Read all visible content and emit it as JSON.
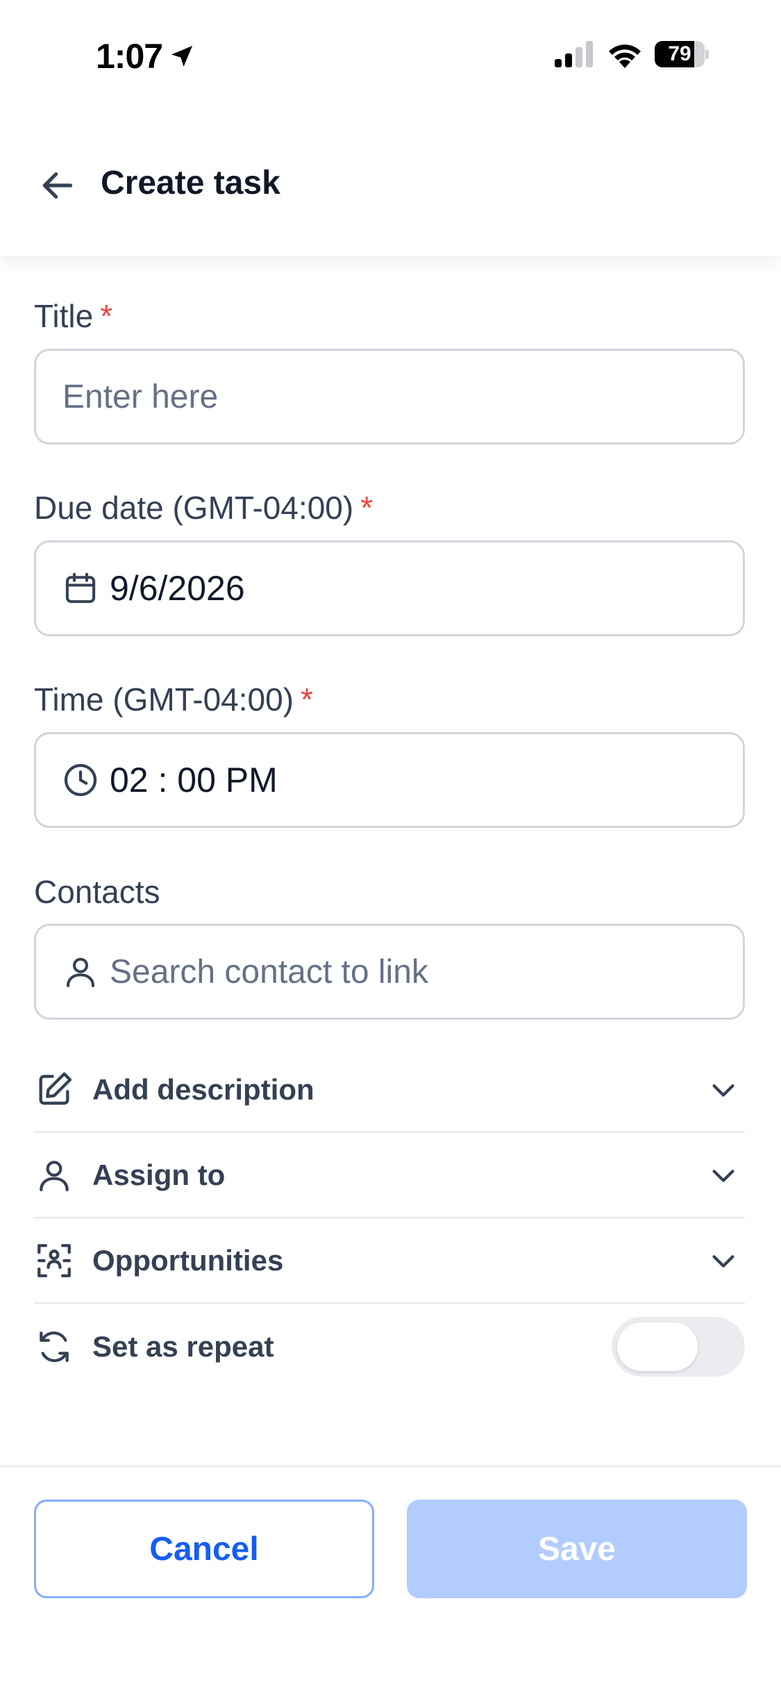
{
  "status_bar": {
    "time": "1:07",
    "battery": "79",
    "battery_level": 0.79
  },
  "header": {
    "title": "Create task",
    "back_icon": "arrow-left-icon"
  },
  "form": {
    "title_field": {
      "label": "Title",
      "required_mark": "*",
      "placeholder": "Enter here"
    },
    "due_date_field": {
      "label": "Due date (GMT-04:00)",
      "required_mark": "*",
      "value": "9/6/2026",
      "icon": "calendar-icon"
    },
    "time_field": {
      "label": "Time (GMT-04:00)",
      "required_mark": "*",
      "value": "02 : 00 PM",
      "icon": "clock-icon"
    },
    "contacts_field": {
      "label": "Contacts",
      "placeholder": "Search contact to link",
      "icon": "user-icon"
    }
  },
  "sections": [
    {
      "label": "Add description",
      "icon": "edit-icon"
    },
    {
      "label": "Assign to",
      "icon": "user-icon"
    },
    {
      "label": "Opportunities",
      "icon": "opportunities-icon"
    },
    {
      "label": "Set as repeat",
      "icon": "repeat-icon",
      "toggle_on": false
    }
  ],
  "footer": {
    "cancel_label": "Cancel",
    "save_label": "Save"
  },
  "colors": {
    "primary": "#155eef",
    "save_disabled": "#b2ccff",
    "required": "#ef4444",
    "border": "#d0d5dd"
  }
}
